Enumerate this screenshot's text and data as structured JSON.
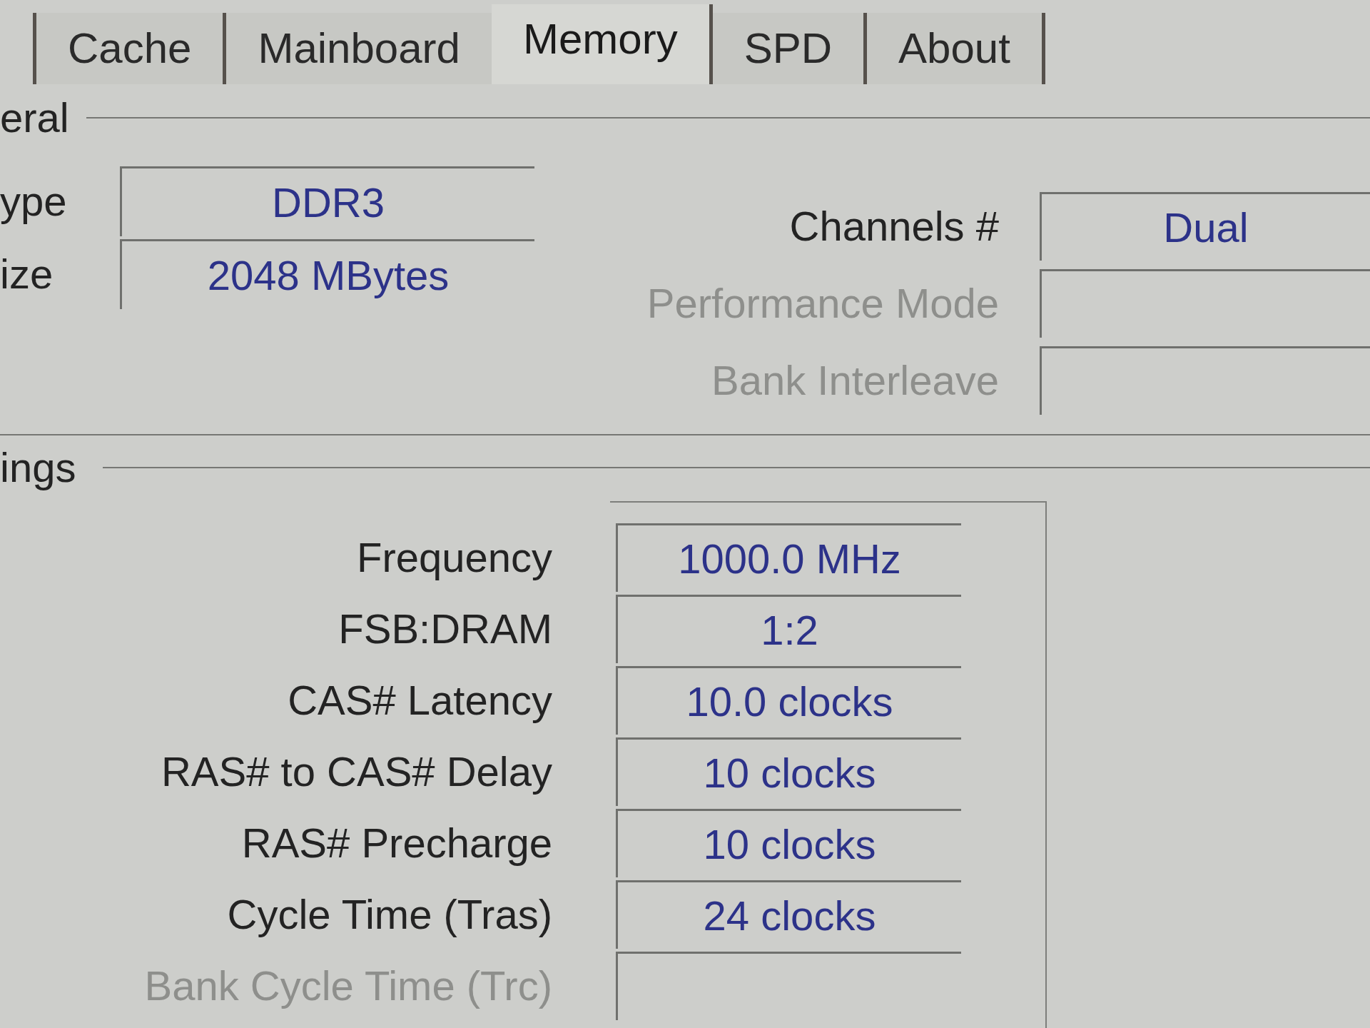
{
  "tabs": [
    {
      "label": "Cache",
      "selected": false
    },
    {
      "label": "Mainboard",
      "selected": false
    },
    {
      "label": "Memory",
      "selected": true
    },
    {
      "label": "SPD",
      "selected": false
    },
    {
      "label": "About",
      "selected": false
    }
  ],
  "general": {
    "title": "eral",
    "left_fields": [
      {
        "label": "ype",
        "value": "DDR3"
      },
      {
        "label": "ize",
        "value": "2048 MBytes"
      }
    ],
    "right_fields": [
      {
        "label": "Channels #",
        "value": "Dual",
        "disabled": false
      },
      {
        "label": "Performance Mode",
        "disabled": true
      },
      {
        "label": "Bank Interleave",
        "disabled": true
      }
    ]
  },
  "timings": {
    "title": "ings",
    "rows": [
      {
        "label": "Frequency",
        "value": "1000.0 MHz",
        "disabled": false
      },
      {
        "label": "FSB:DRAM",
        "value": "1:2",
        "disabled": false
      },
      {
        "label": "CAS# Latency",
        "value": "10.0 clocks",
        "disabled": false
      },
      {
        "label": "RAS# to CAS# Delay",
        "value": "10 clocks",
        "disabled": false
      },
      {
        "label": "RAS# Precharge",
        "value": "10 clocks",
        "disabled": false
      },
      {
        "label": "Cycle Time (Tras)",
        "value": "24 clocks",
        "disabled": false
      },
      {
        "label": "Bank Cycle Time (Trc)",
        "disabled": true
      }
    ]
  }
}
